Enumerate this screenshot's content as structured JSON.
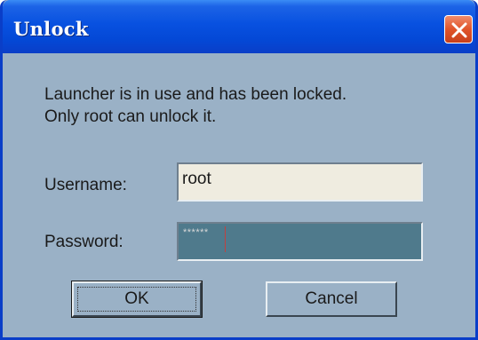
{
  "window": {
    "title": "Unlock",
    "close_icon": "close-icon"
  },
  "message": {
    "line1": "Launcher is in use and has been locked.",
    "line2": "Only root can unlock it."
  },
  "form": {
    "username_label": "Username:",
    "username_value": "root",
    "password_label": "Password:",
    "password_value": "******"
  },
  "buttons": {
    "ok_label": "OK",
    "cancel_label": "Cancel"
  },
  "colors": {
    "titlebar": "#0851e0",
    "dialog_background": "#9ab1c6",
    "close_button": "#e0542a",
    "username_field": "#efece0",
    "password_field": "#4f7a8c"
  }
}
